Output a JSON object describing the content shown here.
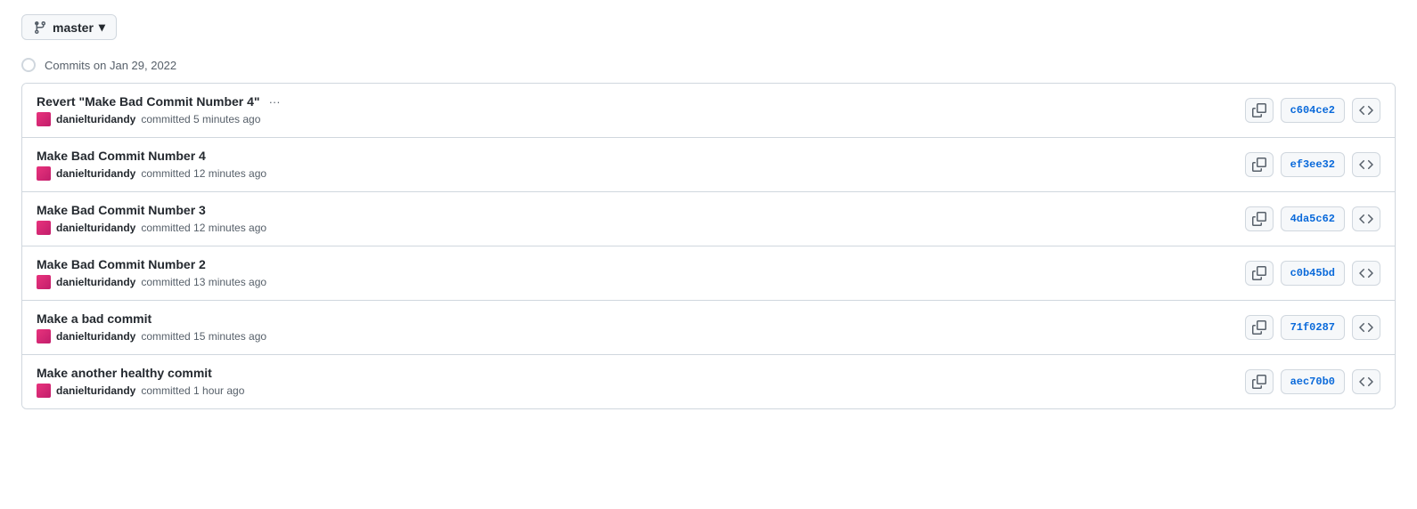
{
  "branch": {
    "label": "master",
    "dropdown_arrow": "▾"
  },
  "date_header": {
    "text": "Commits on Jan 29, 2022"
  },
  "commits": [
    {
      "title": "Revert \"Make Bad Commit Number 4\"",
      "has_ellipsis": true,
      "author": "danielturidandy",
      "time_text": "committed 5 minutes ago",
      "hash": "c604ce2"
    },
    {
      "title": "Make Bad Commit Number 4",
      "has_ellipsis": false,
      "author": "danielturidandy",
      "time_text": "committed 12 minutes ago",
      "hash": "ef3ee32"
    },
    {
      "title": "Make Bad Commit Number 3",
      "has_ellipsis": false,
      "author": "danielturidandy",
      "time_text": "committed 12 minutes ago",
      "hash": "4da5c62"
    },
    {
      "title": "Make Bad Commit Number 2",
      "has_ellipsis": false,
      "author": "danielturidandy",
      "time_text": "committed 13 minutes ago",
      "hash": "c0b45bd"
    },
    {
      "title": "Make a bad commit",
      "has_ellipsis": false,
      "author": "danielturidandy",
      "time_text": "committed 15 minutes ago",
      "hash": "71f0287"
    },
    {
      "title": "Make another healthy commit",
      "has_ellipsis": false,
      "author": "danielturidandy",
      "time_text": "committed 1 hour ago",
      "hash": "aec70b0"
    }
  ],
  "icons": {
    "copy": "⧉",
    "code": "<>",
    "branch": "⑂"
  }
}
